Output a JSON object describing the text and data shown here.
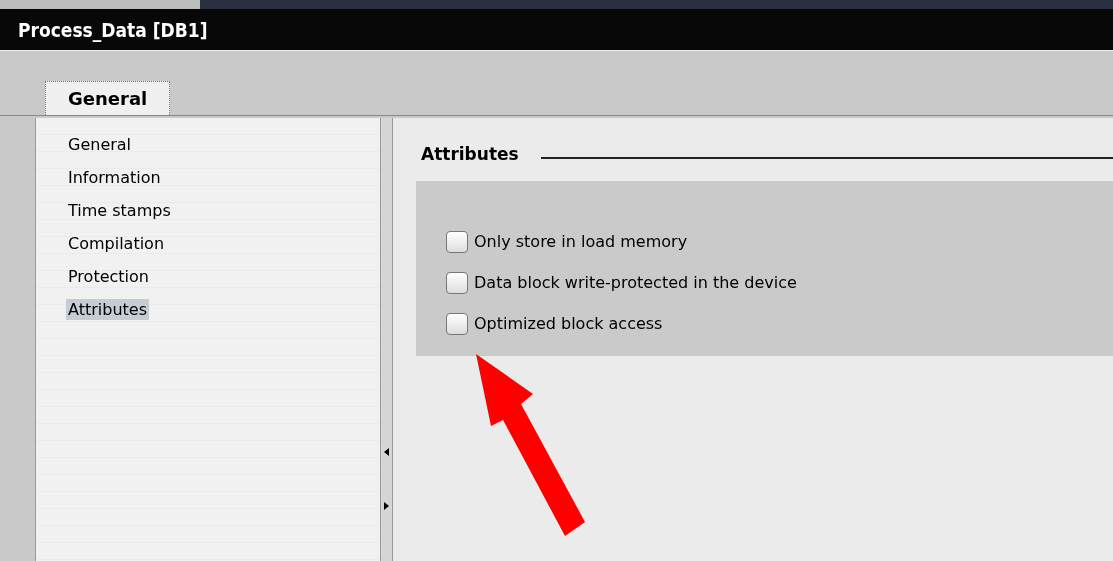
{
  "window": {
    "title": "Process_Data [DB1]"
  },
  "tabs": [
    {
      "label": "General",
      "selected": true
    }
  ],
  "sidebar": {
    "items": [
      {
        "label": "General",
        "selected": false
      },
      {
        "label": "Information",
        "selected": false
      },
      {
        "label": "Time stamps",
        "selected": false
      },
      {
        "label": "Compilation",
        "selected": false
      },
      {
        "label": "Protection",
        "selected": false
      },
      {
        "label": "Attributes",
        "selected": true
      }
    ]
  },
  "section": {
    "title": "Attributes",
    "options": [
      {
        "label": "Only store in load memory",
        "checked": false
      },
      {
        "label": "Data block write-protected in the device",
        "checked": false
      },
      {
        "label": "Optimized block access",
        "checked": false
      }
    ]
  }
}
